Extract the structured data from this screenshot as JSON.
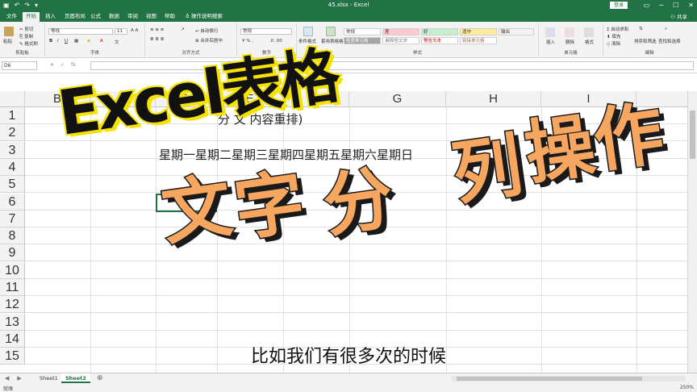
{
  "titlebar": {
    "doc_title": "45.xlsx  -  Excel",
    "login": "登录",
    "save_icon": "save-icon",
    "undo_icon": "undo-icon",
    "redo_icon": "redo-icon"
  },
  "tabs": {
    "items": [
      "文件",
      "开始",
      "插入",
      "页面布局",
      "公式",
      "数据",
      "审阅",
      "视图",
      "帮助"
    ],
    "tell_me": "操作说明搜索",
    "share": "共享"
  },
  "ribbon": {
    "clipboard": {
      "label": "剪贴板",
      "paste": "粘贴",
      "cut": "剪切",
      "copy": "复制",
      "format_painter": "格式刷"
    },
    "font": {
      "label": "字体",
      "name": "等线",
      "size": "11"
    },
    "alignment": {
      "label": "对齐方式",
      "wrap": "自动换行",
      "merge": "合并后居中"
    },
    "number": {
      "label": "数字",
      "format": "常规"
    },
    "styles": {
      "label": "样式",
      "conditional": "条件格式",
      "table": "套用表格格式",
      "cells": [
        "常规",
        "差",
        "好",
        "适中",
        "检查单元格",
        "解释性文本",
        "警告文本",
        "链接单元格",
        "输出"
      ]
    },
    "cells": {
      "label": "单元格",
      "insert": "插入",
      "delete": "删除",
      "format": "格式"
    },
    "editing": {
      "label": "编辑",
      "autosum": "自动求和",
      "fill": "填充",
      "clear": "清除",
      "sort": "排序和筛选",
      "find": "查找和选择"
    }
  },
  "formula_bar": {
    "name_box": "D6",
    "formula": ""
  },
  "columns": [
    "B",
    "C",
    "D",
    "E",
    "F",
    "G",
    "H",
    "I"
  ],
  "rows": [
    "1",
    "2",
    "3",
    "4",
    "5",
    "6",
    "7",
    "8",
    "9",
    "10",
    "11",
    "12",
    "13",
    "14",
    "15"
  ],
  "cells": {
    "row1": "分         文         内容重排)",
    "row3": "星期一星期二星期三星期四星期五星期六星期日"
  },
  "sheets": {
    "tabs": [
      "Sheet1",
      "Sheet2"
    ],
    "active": "Sheet2"
  },
  "status": {
    "ready": "就绪",
    "zoom": "250%"
  },
  "overlay": {
    "line1": "Excel表格",
    "chars": [
      "文",
      "字",
      "分",
      "列",
      "操",
      "作"
    ]
  },
  "subtitle": "比如我们有很多次的时候",
  "colors": {
    "excel_green": "#217346",
    "overlay_orange": "#f7a65f",
    "overlay_yellow": "#f5e200"
  }
}
